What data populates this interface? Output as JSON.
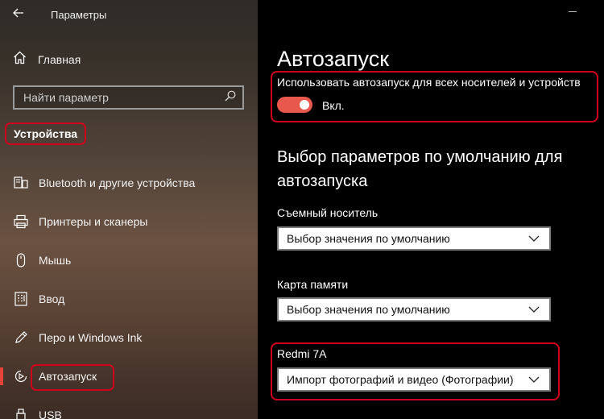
{
  "window": {
    "title": "Параметры"
  },
  "sidebar": {
    "home_label": "Главная",
    "search_placeholder": "Найти параметр",
    "section_title": "Устройства",
    "items": [
      {
        "label": "Bluetooth и другие устройства",
        "icon": "bluetooth-devices-icon"
      },
      {
        "label": "Принтеры и сканеры",
        "icon": "printer-icon"
      },
      {
        "label": "Мышь",
        "icon": "mouse-icon"
      },
      {
        "label": "Ввод",
        "icon": "keyboard-icon"
      },
      {
        "label": "Перо и Windows Ink",
        "icon": "pen-icon"
      },
      {
        "label": "Автозапуск",
        "icon": "autoplay-icon",
        "active": true
      },
      {
        "label": "USB",
        "icon": "usb-icon"
      }
    ]
  },
  "main": {
    "page_title": "Автозапуск",
    "toggle": {
      "description": "Использовать автозапуск для всех носителей и устройств",
      "state_label": "Вкл.",
      "on": true
    },
    "defaults_heading": "Выбор параметров по умолчанию для автозапуска",
    "fields": [
      {
        "label": "Съемный носитель",
        "value": "Выбор значения по умолчанию"
      },
      {
        "label": "Карта памяти",
        "value": "Выбор значения по умолчанию"
      },
      {
        "label": "Redmi 7A",
        "value": "Импорт фотографий и видео (Фотографии)"
      }
    ]
  },
  "colors": {
    "accent": "#e8584c",
    "highlight": "#d0021b"
  }
}
